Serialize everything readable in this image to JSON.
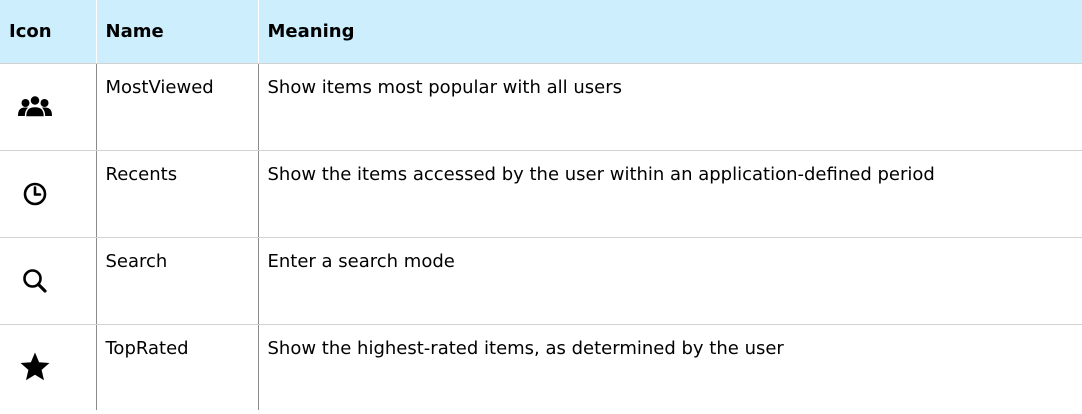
{
  "table": {
    "headers": {
      "icon": "Icon",
      "name": "Name",
      "meaning": "Meaning"
    },
    "rows": [
      {
        "icon": "most-viewed-people-icon",
        "name": "MostViewed",
        "meaning": "Show items most popular with all users"
      },
      {
        "icon": "clock-icon",
        "name": "Recents",
        "meaning": "Show the items accessed by the user within an application-defined period"
      },
      {
        "icon": "search-magnifier-icon",
        "name": "Search",
        "meaning": "Enter a search mode"
      },
      {
        "icon": "star-icon",
        "name": "TopRated",
        "meaning": "Show the highest-rated items, as determined by the user"
      }
    ]
  },
  "colors": {
    "header_background": "#cdeefd",
    "row_divider": "#d2d2d2",
    "column_divider": "#8a8a8a"
  }
}
